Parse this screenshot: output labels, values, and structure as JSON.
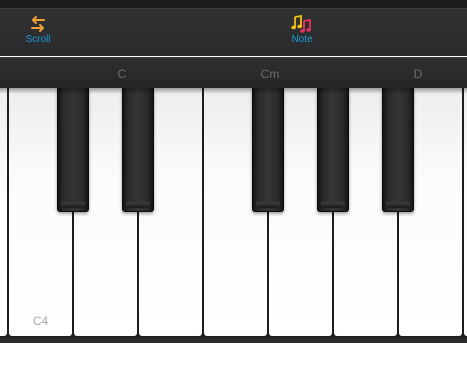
{
  "toolbar": {
    "scroll": {
      "label": "Scroll",
      "icon": "swap-arrows-icon",
      "icon_color": "#f0a030"
    },
    "note": {
      "label": "Note",
      "icon": "music-notes-icon",
      "icon_colors": [
        "#f2c318",
        "#e8315f"
      ]
    },
    "label_color": "#1a9bde"
  },
  "chord_bar": {
    "chords": [
      "C",
      "Cm",
      "D"
    ]
  },
  "keyboard": {
    "white_key_labels": [
      "",
      "C4",
      "",
      "",
      "",
      "",
      "",
      "",
      ""
    ],
    "black_key_count": 5
  }
}
